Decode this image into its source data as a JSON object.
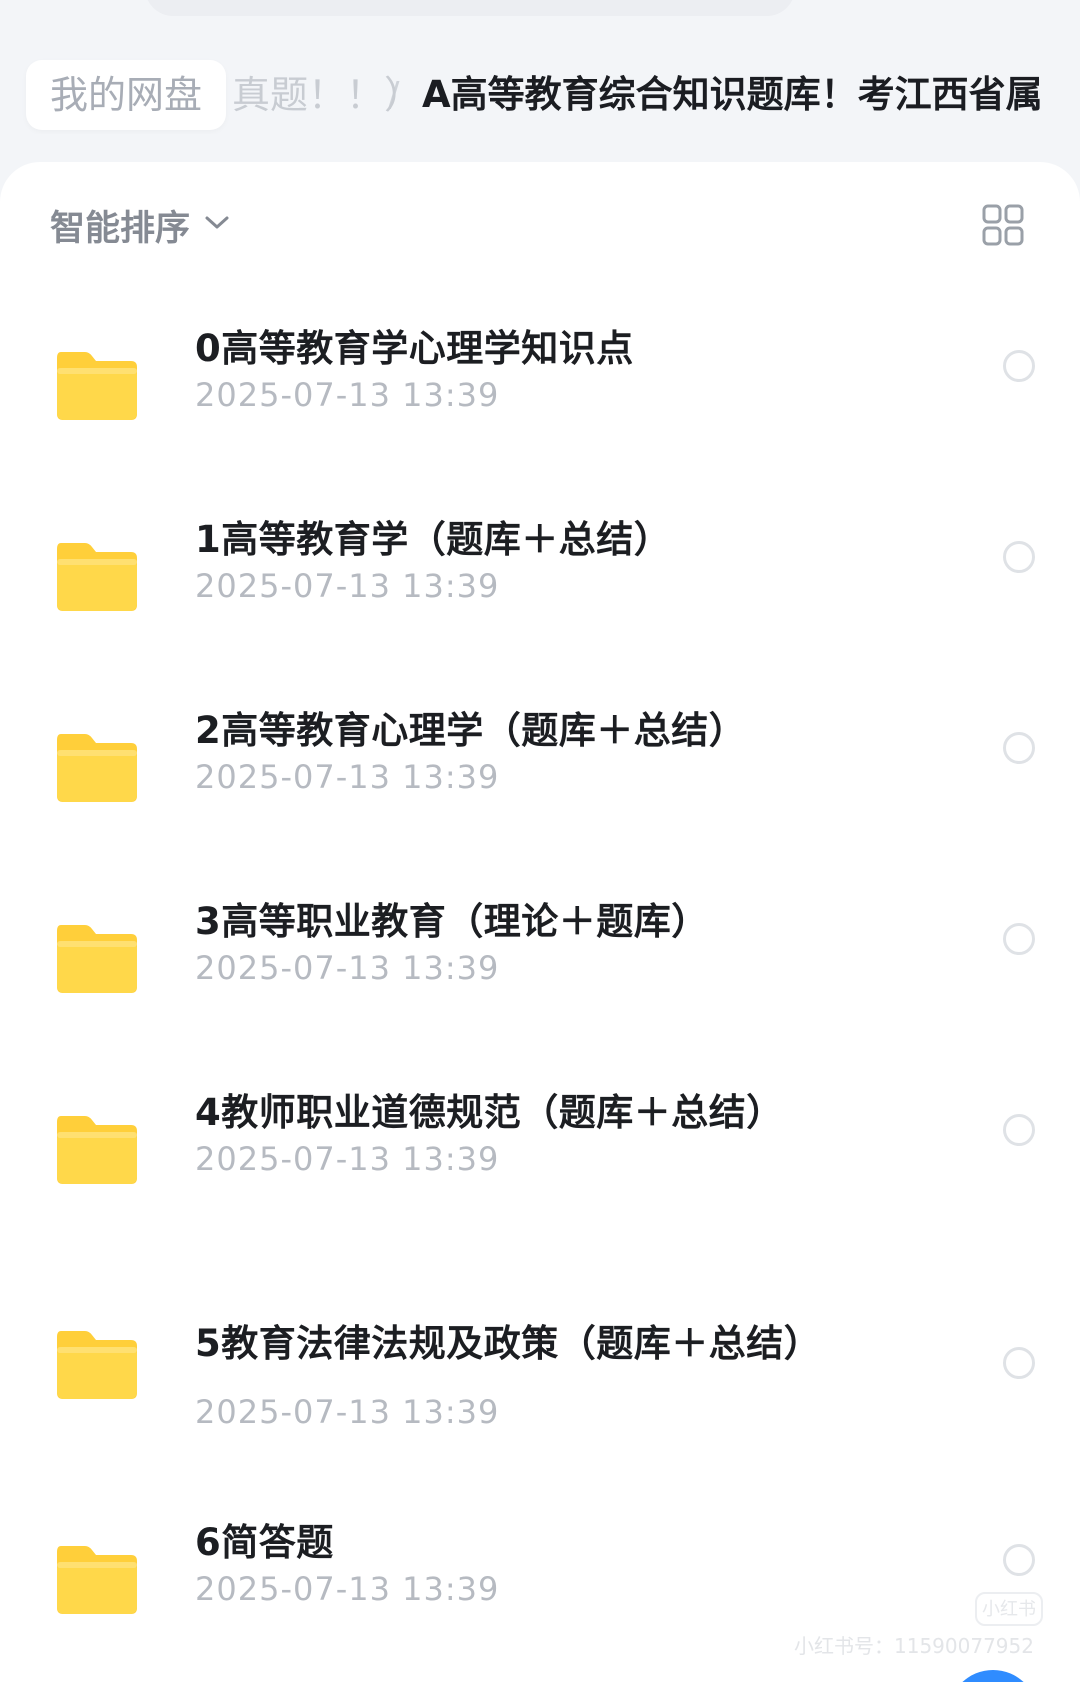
{
  "breadcrumb": {
    "root": "我的网盘",
    "middle": "真题！！）",
    "separator": "/",
    "current": "A高等教育综合知识题库！考江西省属"
  },
  "toolbar": {
    "sort_label": "智能排序",
    "sort_icon": "chevron-down-icon",
    "view_icon": "grid-view-icon"
  },
  "files": [
    {
      "name": "0高等教育学心理学知识点",
      "date": "2025-07-13 13:39"
    },
    {
      "name": "1高等教育学（题库＋总结）",
      "date": "2025-07-13 13:39"
    },
    {
      "name": "2高等教育心理学（题库＋总结）",
      "date": "2025-07-13 13:39"
    },
    {
      "name": "3高等职业教育（理论＋题库）",
      "date": "2025-07-13 13:39"
    },
    {
      "name": "4教师职业道德规范（题库＋总结）",
      "date": "2025-07-13 13:39"
    },
    {
      "name": "5教育法律法规及政策（题库＋总结）",
      "date": "2025-07-13 13:39"
    },
    {
      "name": "6简答题",
      "date": "2025-07-13 13:39"
    }
  ],
  "watermark": {
    "badge": "小红书",
    "id_text": "小红书号：11590077952"
  },
  "colors": {
    "folder": "#ffd84a",
    "accent": "#2f8cff"
  }
}
